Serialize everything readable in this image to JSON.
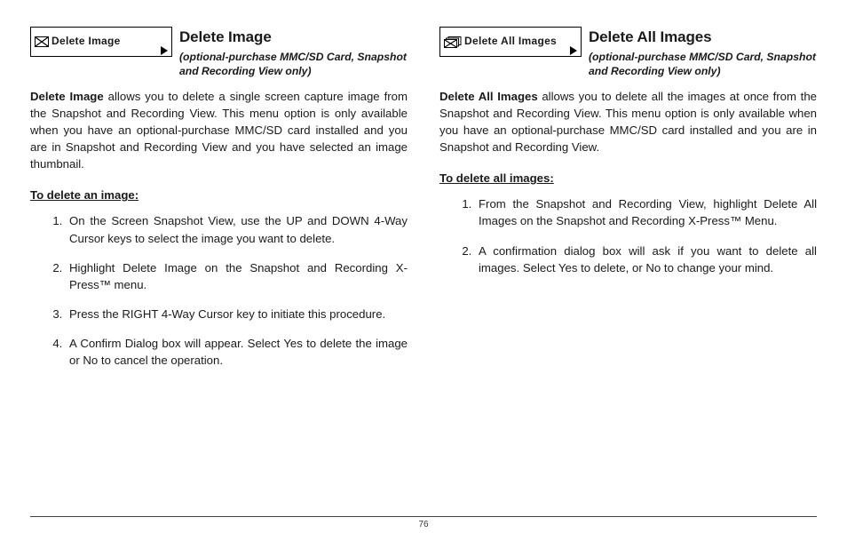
{
  "page_number": "76",
  "left": {
    "menu_label": "Delete Image",
    "title": "Delete Image",
    "subtitle": "(optional-purchase MMC/SD Card, Snapshot and Recording View only)",
    "intro_bold": "Delete Image",
    "intro_rest": " allows you to delete a single screen capture image from the Snapshot and Recording View. This menu option is only available when you have an optional-purchase MMC/SD card installed and you are in Snapshot and Recording View and you have selected an image thumbnail.",
    "steps_heading": "To delete an image:",
    "steps": [
      "On the Screen Snapshot View, use the UP and DOWN 4-Way Cursor keys to select the image you want to delete.",
      "Highlight Delete Image on the Snapshot and Recording X-Press™ menu.",
      "Press the RIGHT 4-Way Cursor key to initiate this procedure.",
      "A Confirm Dialog box will appear. Select Yes to delete the image or No to cancel the operation."
    ]
  },
  "right": {
    "menu_label": "Delete All Images",
    "title": "Delete All Images",
    "subtitle": "(optional-purchase MMC/SD Card, Snapshot and Recording View only)",
    "intro_bold": "Delete All Images",
    "intro_rest": " allows you to delete all the images at once from the Snapshot and Recording View. This menu option is only available when you have an optional-purchase MMC/SD card installed and you are in Snapshot and Recording View.",
    "steps_heading": "To delete all images:",
    "steps": [
      "From the Snapshot and Recording View, highlight Delete All Images on the Snapshot and Recording X-Press™ Menu.",
      "A confirmation dialog box will ask if you want to delete all images. Select Yes to delete, or No to change your mind."
    ]
  }
}
